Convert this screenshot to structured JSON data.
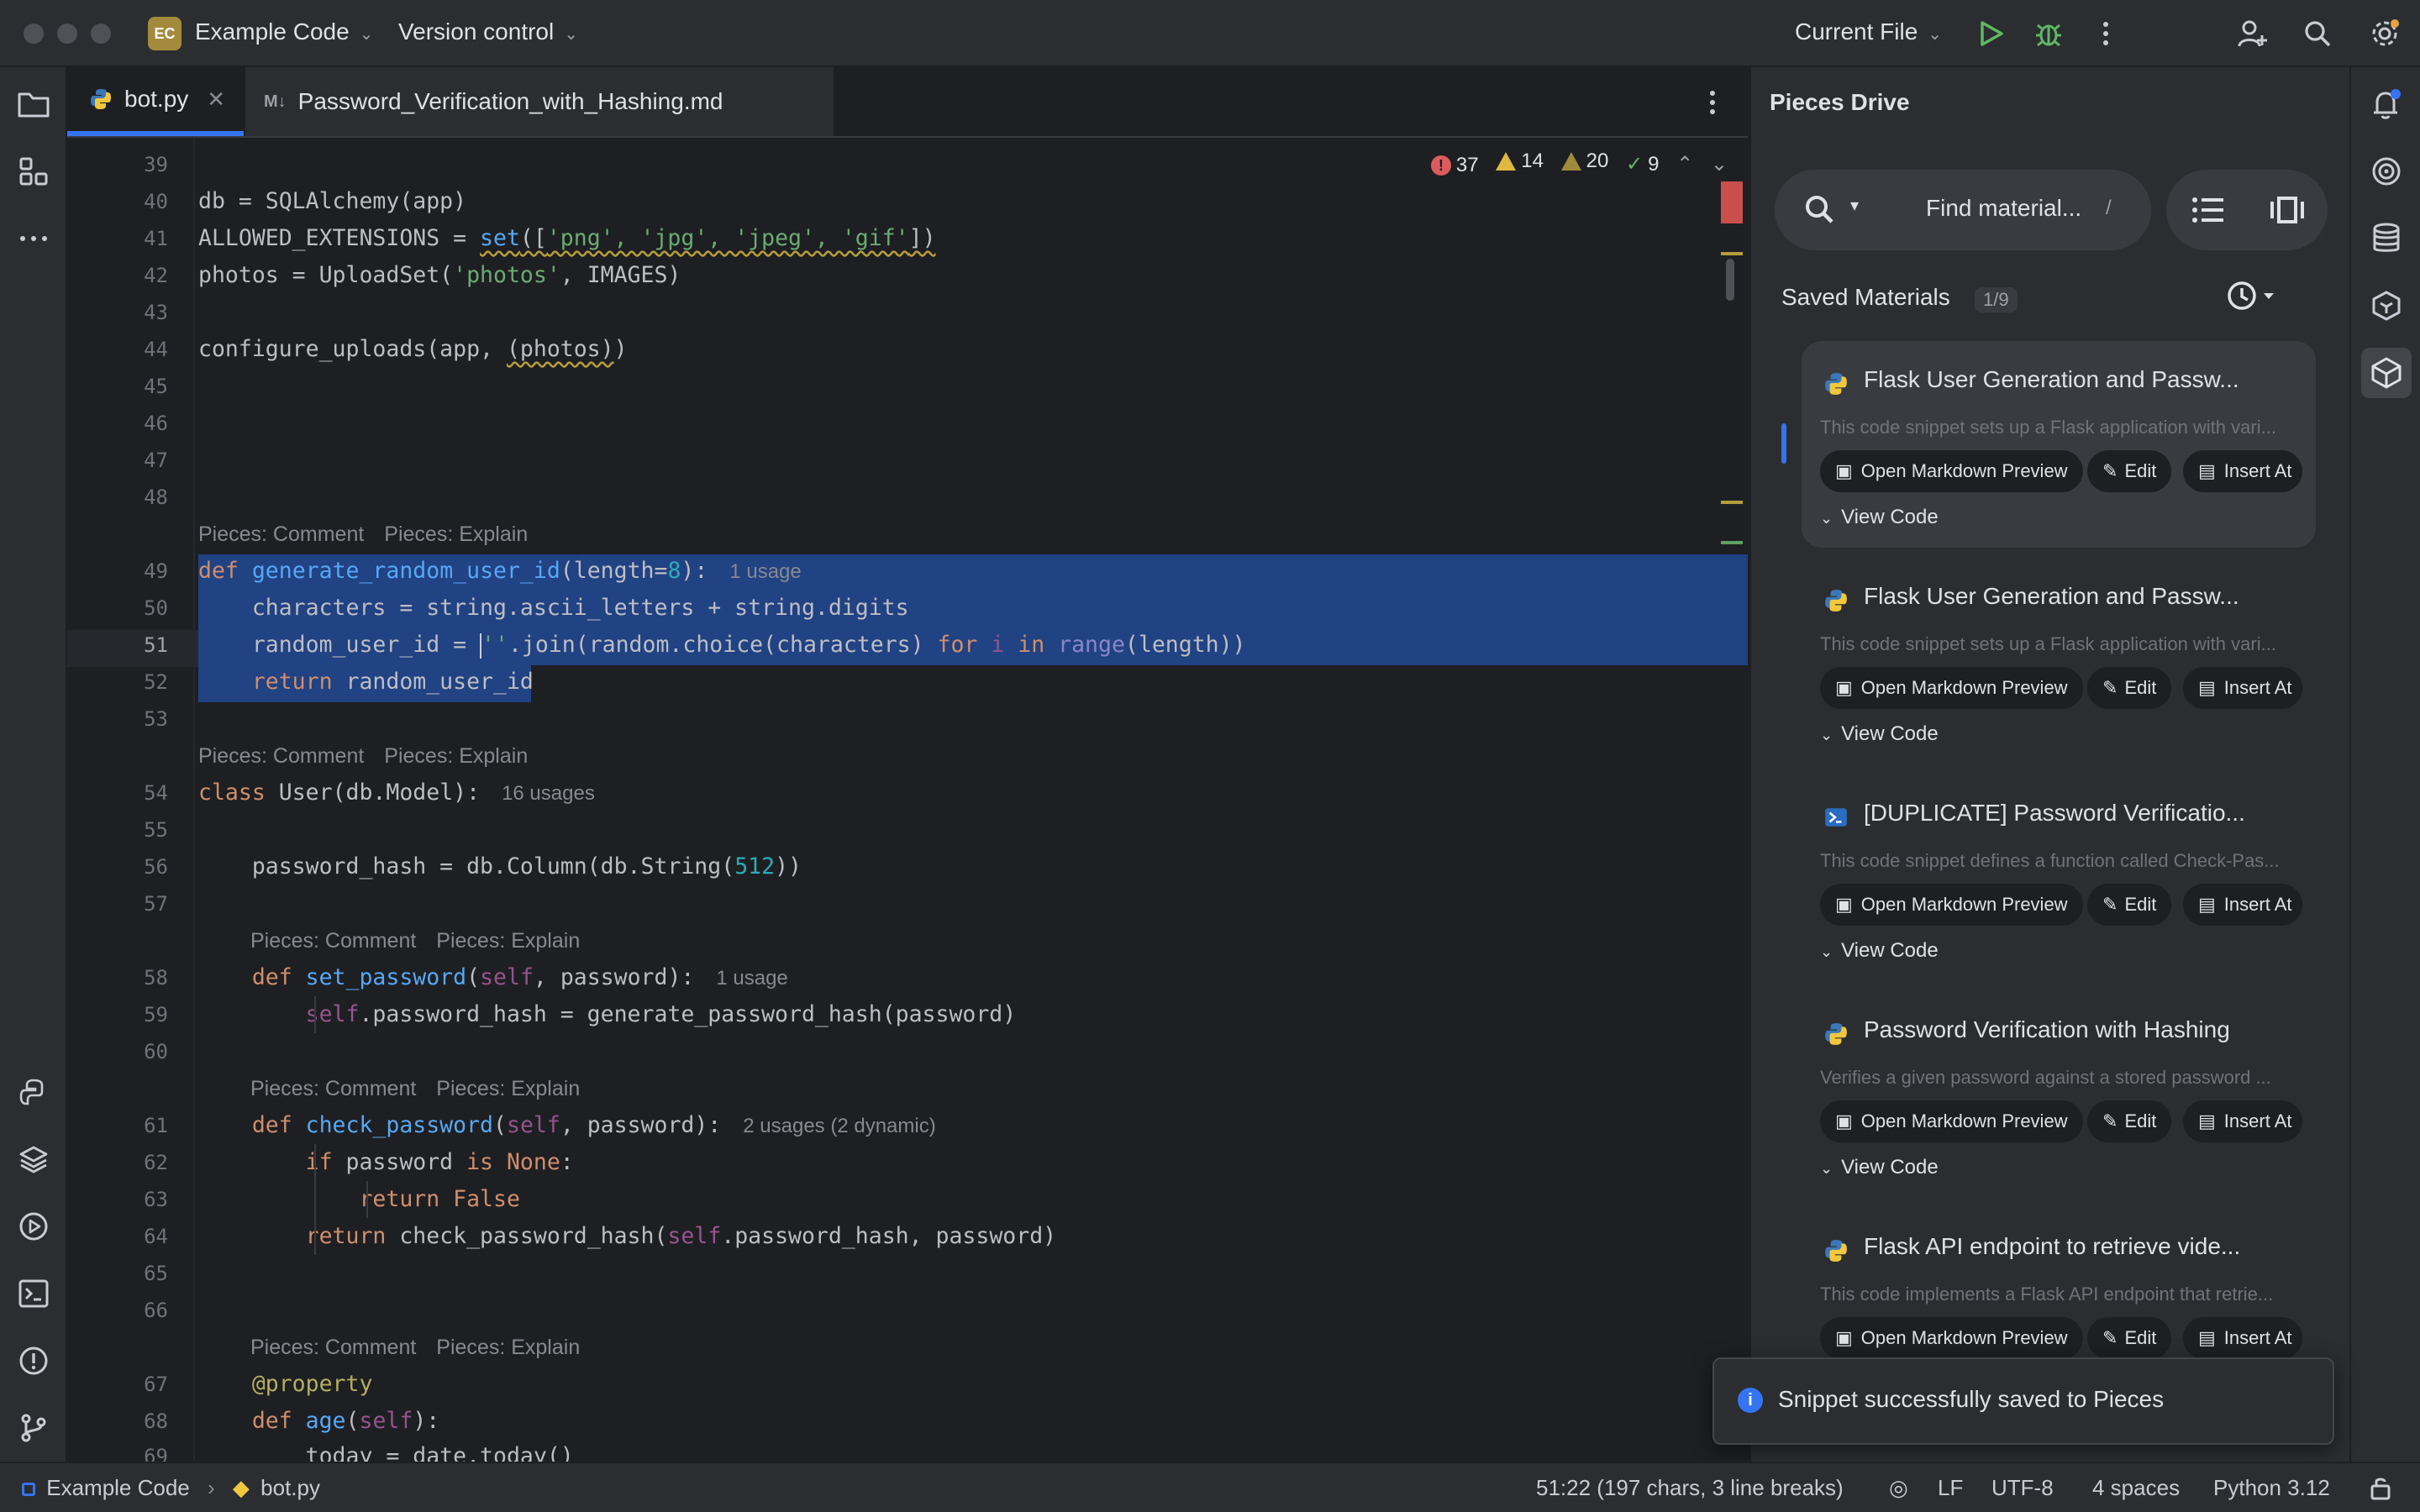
{
  "titlebar": {
    "project_badge": "EC",
    "project_name": "Example Code",
    "vcs": "Version control",
    "run_config": "Current File"
  },
  "tabs": [
    {
      "label": "bot.py",
      "icon": "python-file-icon"
    },
    {
      "label": "Password_Verification_with_Hashing.md",
      "icon": "markdown-file-icon",
      "icon_text": "M↓"
    }
  ],
  "inspections": {
    "errors": "37",
    "warnings": "14",
    "weak_warnings": "20",
    "ok": "9"
  },
  "editor": {
    "line_numbers": [
      "39",
      "40",
      "41",
      "42",
      "43",
      "44",
      "45",
      "46",
      "47",
      "48",
      "49",
      "50",
      "51",
      "52",
      "53",
      "54",
      "55",
      "56",
      "57",
      "58",
      "59",
      "60",
      "61",
      "62",
      "63",
      "64",
      "65",
      "66",
      "67",
      "68",
      "69"
    ],
    "current_line": "51",
    "code": {
      "l40": "db = SQLAlchemy(app)",
      "l41_a": "ALLOWED_EXTENSIONS = ",
      "l41_b": "set",
      "l41_c": "([",
      "l41_d": "'png', 'jpg', 'jpeg', 'gif'",
      "l41_e": "])",
      "l42_a": "photos = UploadSet(",
      "l42_b": "'photos'",
      "l42_c": ", IMAGES)",
      "l44_a": "configure_uploads(app, ",
      "l44_b": "(photos)",
      "l44_c": ")",
      "l49_def": "def",
      "l49_fn": "generate_random_user_id",
      "l49_a": "(length=",
      "l49_num": "8",
      "l49_b": "):",
      "l49_hint": "1 usage",
      "l50": "    characters = string.ascii_letters + string.digits",
      "l51_a": "    random_user_id = ",
      "l51_str": "''",
      "l51_b": ".join(random.choice(characters) ",
      "l51_for": "for",
      "l51_i": " i ",
      "l51_in": "in",
      "l51_range": " range",
      "l51_c": "(length))",
      "l52_ret": "    return",
      "l52_a": " random_user_id",
      "l54_cls": "class",
      "l54_a": " User(db.Model):",
      "l54_hint": "16 usages",
      "l56_a": "    password_hash = db.Column(db.String(",
      "l56_num": "512",
      "l56_b": "))",
      "l58_def": "    def",
      "l58_fn": " set_password",
      "l58_a": "(",
      "l58_self": "self",
      "l58_b": ", password):",
      "l58_hint": "1 usage",
      "l59_self": "        self",
      "l59_a": ".password_hash = generate_password_hash(password)",
      "l61_def": "    def",
      "l61_fn": " check_password",
      "l61_a": "(",
      "l61_self": "self",
      "l61_b": ", password):",
      "l61_hint": "2 usages (2 dynamic)",
      "l62_if": "        if",
      "l62_a": " password ",
      "l62_is": "is None",
      "l62_b": ":",
      "l63_ret": "            return False",
      "l64_ret": "        return",
      "l64_a": " check_password_hash(",
      "l64_self": "self",
      "l64_b": ".password_hash, password)",
      "l67_dec": "    @property",
      "l68_def": "    def",
      "l68_fn": " age",
      "l68_a": "(",
      "l68_self": "self",
      "l68_b": "):",
      "l69": "        today = date.today()"
    },
    "lens_comment": "Pieces: Comment",
    "lens_explain": "Pieces: Explain"
  },
  "panel": {
    "title": "Pieces Drive",
    "search_placeholder": "Find material...",
    "search_shortcut": "/",
    "saved_label": "Saved Materials",
    "saved_count": "1/9",
    "btn_preview": "Open Markdown Preview",
    "btn_edit": "Edit",
    "btn_insert": "Insert At",
    "view_code": "View Code",
    "cards": [
      {
        "title": "Flask User Generation and Passw...",
        "desc": "This code snippet sets up a Flask application with vari...",
        "lang": "python"
      },
      {
        "title": "Flask User Generation and Passw...",
        "desc": "This code snippet sets up a Flask application with vari...",
        "lang": "python"
      },
      {
        "title": "[DUPLICATE] Password Verificatio...",
        "desc": "This code snippet defines a function called Check-Pas...",
        "lang": "powershell"
      },
      {
        "title": "Password Verification with Hashing",
        "desc": "Verifies a given password against a stored password ...",
        "lang": "python"
      },
      {
        "title": "Flask API endpoint to retrieve vide...",
        "desc": "This code implements a Flask API endpoint that retrie...",
        "lang": "python"
      }
    ]
  },
  "toast": {
    "message": "Snippet successfully saved to Pieces"
  },
  "statusbar": {
    "project": "Example Code",
    "file": "bot.py",
    "position": "51:22 (197 chars, 3 line breaks)",
    "line_sep": "LF",
    "encoding": "UTF-8",
    "indent": "4 spaces",
    "interpreter": "Python 3.12"
  },
  "colors": {
    "accent": "#3574f0",
    "selection": "#214283",
    "error": "#db5c5c",
    "warning": "#e0b840",
    "ok": "#5fb865",
    "run": "#5fb865"
  }
}
